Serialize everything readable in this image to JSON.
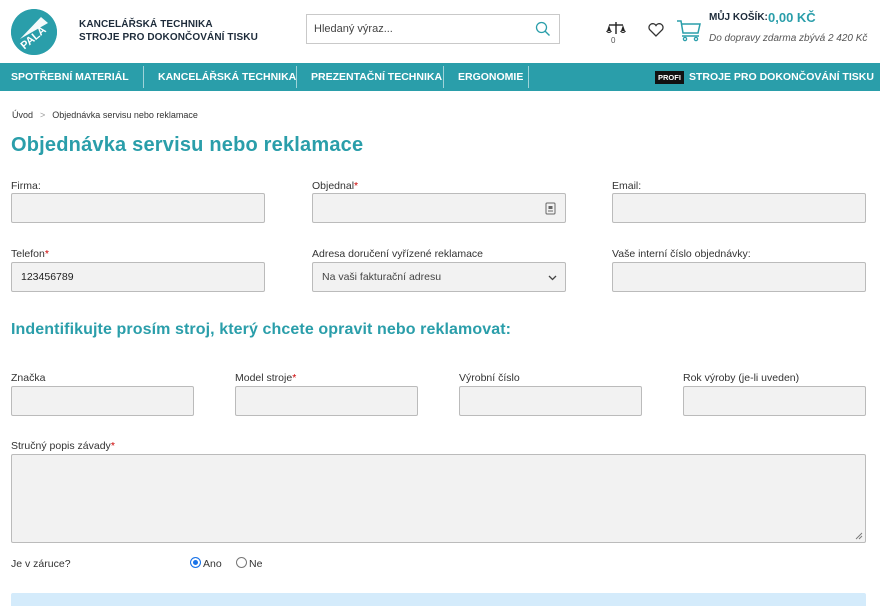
{
  "header": {
    "brand_line1": "KANCELÁŘSKÁ TECHNIKA",
    "brand_line2": "STROJE PRO DOKONČOVÁNÍ TISKU",
    "search_placeholder": "Hledaný výraz...",
    "compare_count": "0",
    "cart_label": "MŮJ KOŠÍK:",
    "cart_price": "0,00 KČ",
    "cart_note": "Do dopravy zdarma zbývá 2 420 Kč",
    "logo_text": "PALA"
  },
  "nav": {
    "items": [
      "SPOTŘEBNÍ MATERIÁL",
      "KANCELÁŘSKÁ TECHNIKA",
      "PREZENTAČNÍ TECHNIKA",
      "ERGONOMIE"
    ],
    "profi_badge": "PROFI",
    "profi_label": "STROJE PRO DOKONČOVÁNÍ TISKU"
  },
  "breadcrumb": {
    "home": "Úvod",
    "separator": ">",
    "current": "Objednávka servisu nebo reklamace"
  },
  "page_title": "Objednávka servisu nebo reklamace",
  "form": {
    "firma_label": "Firma:",
    "objednal_label": "Objednal",
    "email_label": "Email:",
    "telefon_label": "Telefon",
    "telefon_value": "123456789",
    "adresa_label": "Adresa doručení vyřízené reklamace",
    "adresa_selected": "Na vaši fakturační adresu",
    "interni_label": "Vaše interní číslo objednávky:",
    "required_mark": "*"
  },
  "machine": {
    "section_title": "Indentifikujte prosím stroj, který chcete opravit nebo reklamovat:",
    "znacka_label": "Značka",
    "model_label": "Model stroje",
    "vyrobni_label": "Výrobní číslo",
    "rok_label": "Rok výroby (je-li uveden)",
    "popis_label": "Stručný popis závady",
    "zaruka_label": "Je v záruce?",
    "ano_label": "Ano",
    "ne_label": "Ne"
  },
  "colors": {
    "accent": "#2a9eaa",
    "required": "#cc0000",
    "info_box": "#d4ebfb"
  },
  "icons": [
    "logo",
    "search-icon",
    "compare-scales-icon",
    "heart-icon",
    "cart-icon",
    "chevron-down-icon",
    "key-icon",
    "resize-grip-icon"
  ]
}
